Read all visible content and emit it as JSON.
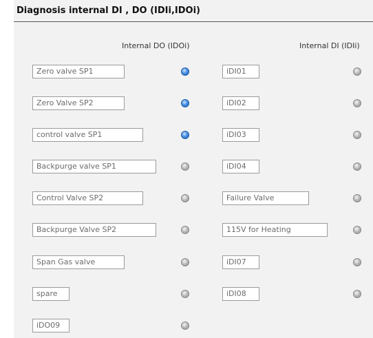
{
  "header": {
    "title": "Diagnosis internal DI , DO (IDIi,IDOi)"
  },
  "columns": {
    "do_label": "Internal DO (IDOi)",
    "di_label": "Internal DI (IDIi)"
  },
  "do_items": [
    {
      "label": "Zero valve SP1",
      "active": true
    },
    {
      "label": "Zero Valve SP2",
      "active": true
    },
    {
      "label": "control valve SP1",
      "active": true
    },
    {
      "label": "Backpurge valve SP1",
      "active": false
    },
    {
      "label": "Control Valve SP2",
      "active": false
    },
    {
      "label": "Backpurge Valve SP2",
      "active": false
    },
    {
      "label": "Span Gas valve",
      "active": false
    },
    {
      "label": "spare",
      "active": false
    },
    {
      "label": "iDO09",
      "active": false
    }
  ],
  "di_items": [
    {
      "label": "iDI01",
      "active": false
    },
    {
      "label": "iDI02",
      "active": false
    },
    {
      "label": "iDI03",
      "active": false
    },
    {
      "label": "iDI04",
      "active": false
    },
    {
      "label": "Failure Valve",
      "active": false
    },
    {
      "label": "115V for Heating",
      "active": false
    },
    {
      "label": "iDI07",
      "active": false
    },
    {
      "label": "iDI08",
      "active": false
    }
  ],
  "colors": {
    "led_on": "#4a90e2",
    "led_off": "#b8b8b8"
  }
}
